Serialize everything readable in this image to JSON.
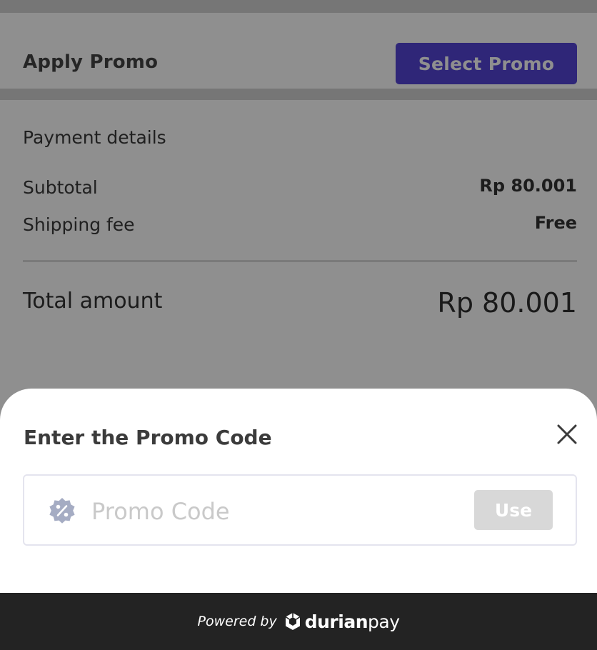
{
  "promo_section": {
    "label": "Apply Promo",
    "select_button": "Select Promo"
  },
  "payment_details": {
    "title": "Payment details",
    "rows": [
      {
        "label": "Subtotal",
        "value": "Rp 80.001"
      },
      {
        "label": "Shipping fee",
        "value": "Free"
      }
    ],
    "total_label": "Total amount",
    "total_value": "Rp 80.001"
  },
  "promo_sheet": {
    "title": "Enter the Promo Code",
    "input_placeholder": "Promo Code",
    "input_value": "",
    "use_button": "Use",
    "close_icon": "close-icon",
    "field_icon": "percent-badge-icon"
  },
  "footer": {
    "powered_by": "Powered by",
    "brand_bold": "durian",
    "brand_light": "pay",
    "brand_icon": "durianpay-logo-icon"
  },
  "colors": {
    "primary": "#5445d6",
    "footer_bg": "#232323",
    "scrim": "rgba(0,0,0,0.44)",
    "disabled_button": "#d8d8d8"
  }
}
